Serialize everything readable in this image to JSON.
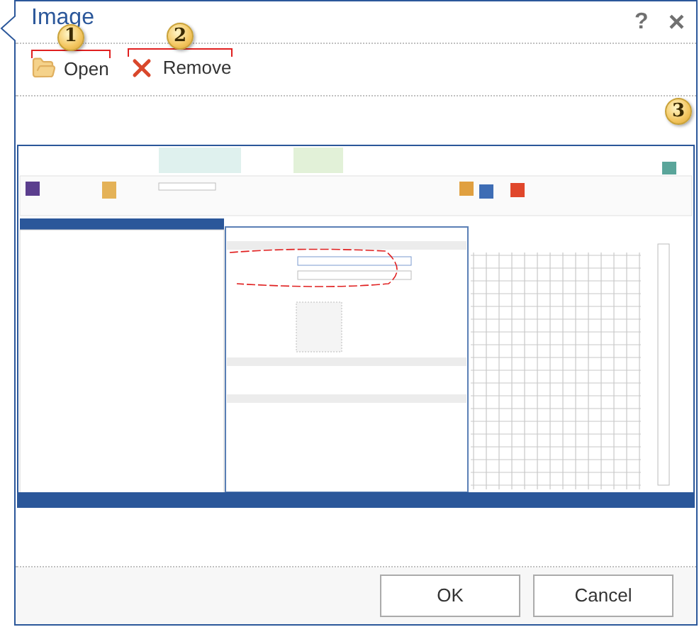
{
  "dialog": {
    "title": "Image",
    "help": "?",
    "close": "×"
  },
  "toolbar": [
    {
      "kind": "open",
      "label": "Open",
      "callout": "1"
    },
    {
      "kind": "remove",
      "label": "Remove",
      "callout": "2"
    }
  ],
  "preview": {
    "callout": "3"
  },
  "buttons": [
    "OK",
    "Cancel"
  ]
}
